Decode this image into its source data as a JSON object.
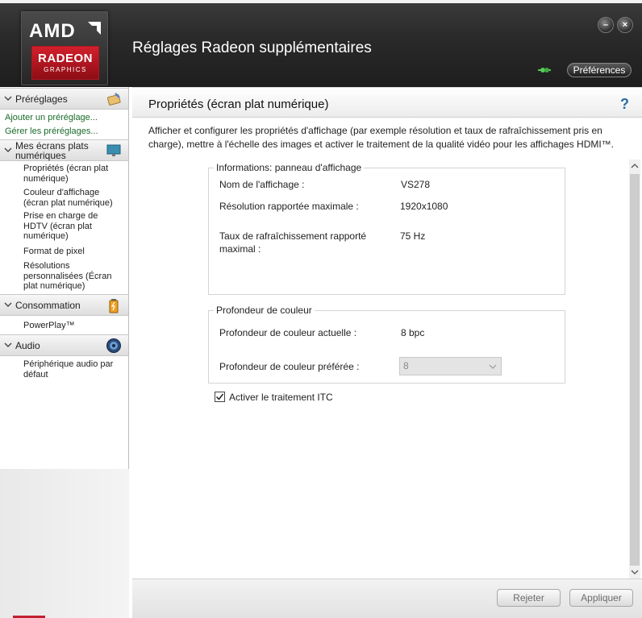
{
  "header": {
    "logo_text": "AMD",
    "logo_badge_1": "RADEON",
    "logo_badge_2": "GRAPHICS",
    "title": "Réglages Radeon supplémentaires",
    "minimize": "–",
    "close": "×",
    "preferences": "Préférences"
  },
  "sidebar": {
    "presets": {
      "label": "Préréglages",
      "links": [
        "Ajouter un préréglage...",
        "Gérer les préréglages..."
      ]
    },
    "displays": {
      "label": "Mes écrans plats numériques",
      "items": [
        "Propriétés (écran plat numérique)",
        "Couleur d'affichage (écran plat numérique)",
        "Prise en charge de HDTV (écran plat numérique)",
        "Format de pixel",
        "Résolutions personnalisées (Écran plat numérique)"
      ]
    },
    "power": {
      "label": "Consommation",
      "items": [
        "PowerPlay™"
      ]
    },
    "audio": {
      "label": "Audio",
      "items": [
        "Périphérique audio par défaut"
      ]
    }
  },
  "main": {
    "title": "Propriétés (écran plat numérique)",
    "help": "?",
    "description": "Afficher et configurer les propriétés d'affichage (par exemple résolution et taux de rafraîchissement pris en charge), mettre à l'échelle des images et activer le traitement de la qualité vidéo pour les affichages HDMI™.",
    "info_panel": {
      "title": "Informations: panneau d'affichage",
      "rows": [
        {
          "label": "Nom de l'affichage :",
          "value": "VS278"
        },
        {
          "label": "Résolution rapportée maximale :",
          "value": "1920x1080"
        },
        {
          "label": "Taux de rafraîchissement rapporté maximal :",
          "value": "75 Hz"
        }
      ]
    },
    "color_depth": {
      "title": "Profondeur de couleur",
      "current_label": "Profondeur de couleur actuelle :",
      "current_value": "8 bpc",
      "preferred_label": "Profondeur de couleur préférée :",
      "preferred_value": "8"
    },
    "itc": {
      "label": "Activer le traitement ITC",
      "checked": true
    },
    "buttons": {
      "reject": "Rejeter",
      "apply": "Appliquer"
    }
  },
  "colors": {
    "header_bg": "#2a2a2a",
    "accent_red": "#c8202c",
    "link_green": "#1a6a2a",
    "help_blue": "#2b6aa8"
  }
}
